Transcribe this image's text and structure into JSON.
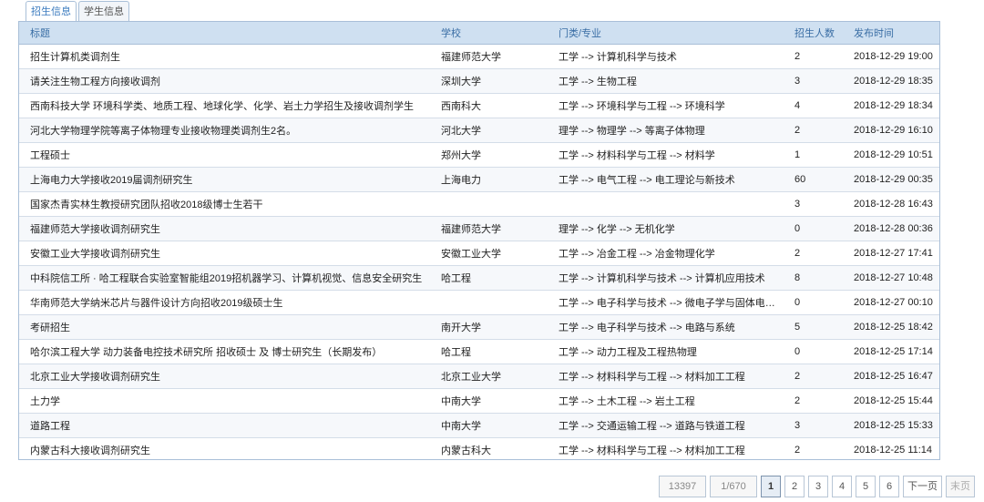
{
  "tabs": [
    "招生信息",
    "学生信息"
  ],
  "table": {
    "headers": [
      "标题",
      "学校",
      "门类/专业",
      "招生人数",
      "发布时间"
    ],
    "rows": [
      [
        "招生计算机类调剂生",
        "福建师范大学",
        "工学 --> 计算机科学与技术",
        "2",
        "2018-12-29 19:00"
      ],
      [
        "请关注生物工程方向接收调剂",
        "深圳大学",
        "工学 --> 生物工程",
        "3",
        "2018-12-29 18:35"
      ],
      [
        "西南科技大学 环境科学类、地质工程、地球化学、化学、岩土力学招生及接收调剂学生",
        "西南科大",
        "工学 --> 环境科学与工程 --> 环境科学",
        "4",
        "2018-12-29 18:34"
      ],
      [
        "河北大学物理学院等离子体物理专业接收物理类调剂生2名。",
        "河北大学",
        "理学 --> 物理学 --> 等离子体物理",
        "2",
        "2018-12-29 16:10"
      ],
      [
        "工程硕士",
        "郑州大学",
        "工学 --> 材料科学与工程 --> 材料学",
        "1",
        "2018-12-29 10:51"
      ],
      [
        "上海电力大学接收2019届调剂研究生",
        "上海电力",
        "工学 --> 电气工程 --> 电工理论与新技术",
        "60",
        "2018-12-29 00:35"
      ],
      [
        "国家杰青实林生教授研究团队招收2018级博士生若干",
        "",
        "",
        "3",
        "2018-12-28 16:43"
      ],
      [
        "福建师范大学接收调剂研究生",
        "福建师范大学",
        "理学 --> 化学 --> 无机化学",
        "0",
        "2018-12-28 00:36"
      ],
      [
        "安徽工业大学接收调剂研究生",
        "安徽工业大学",
        "工学 --> 冶金工程 --> 冶金物理化学",
        "2",
        "2018-12-27 17:41"
      ],
      [
        "中科院信工所 · 哈工程联合实验室智能组2019招机器学习、计算机视觉、信息安全研究生",
        "哈工程",
        "工学 --> 计算机科学与技术 --> 计算机应用技术",
        "8",
        "2018-12-27 10:48"
      ],
      [
        "华南师范大学纳米芯片与器件设计方向招收2019级硕士生",
        "",
        "工学 --> 电子科学与技术 --> 微电子学与固体电子学",
        "0",
        "2018-12-27 00:10"
      ],
      [
        "考研招生",
        "南开大学",
        "工学 --> 电子科学与技术 --> 电路与系统",
        "5",
        "2018-12-25 18:42"
      ],
      [
        "哈尔滨工程大学 动力装备电控技术研究所 招收硕士 及 博士研究生（长期发布）",
        "哈工程",
        "工学 --> 动力工程及工程热物理",
        "0",
        "2018-12-25 17:14"
      ],
      [
        "北京工业大学接收调剂研究生",
        "北京工业大学",
        "工学 --> 材料科学与工程 --> 材料加工工程",
        "2",
        "2018-12-25 16:47"
      ],
      [
        "土力学",
        "中南大学",
        "工学 --> 土木工程 --> 岩土工程",
        "2",
        "2018-12-25 15:44"
      ],
      [
        "道路工程",
        "中南大学",
        "工学 --> 交通运输工程 --> 道路与铁道工程",
        "3",
        "2018-12-25 15:33"
      ],
      [
        "内蒙古科大接收调剂研究生",
        "内蒙古科大",
        "工学 --> 材料科学与工程 --> 材料加工工程",
        "2",
        "2018-12-25 11:14"
      ]
    ]
  },
  "pagination": {
    "total": "13397",
    "page_info": "1/670",
    "pages": [
      "1",
      "2",
      "3",
      "4",
      "5",
      "6"
    ],
    "current": "1",
    "next": "下一页",
    "last": "末页"
  }
}
